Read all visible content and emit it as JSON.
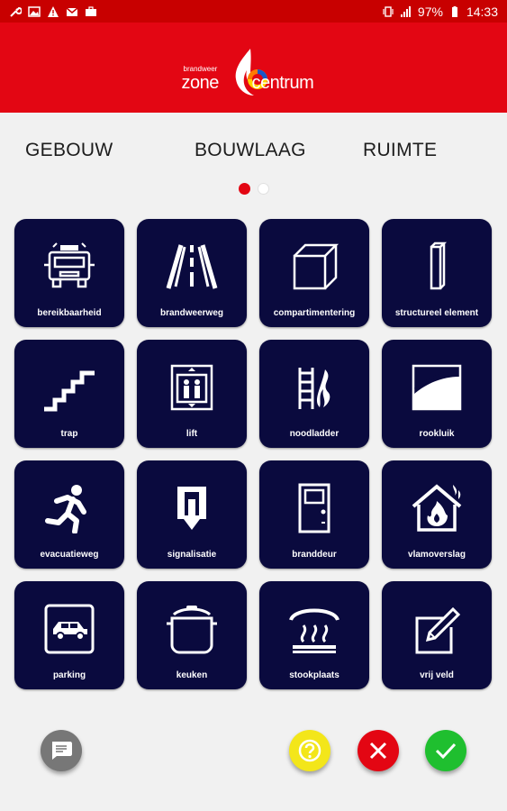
{
  "status_bar": {
    "battery": "97%",
    "time": "14:33",
    "left_icons": [
      "wrench-icon",
      "image-icon",
      "warning-icon",
      "gmail-icon",
      "briefcase-icon"
    ],
    "right_icons": [
      "vibrate-icon",
      "signal-icon",
      "battery-icon"
    ]
  },
  "header": {
    "brand_small": "brandweer",
    "brand_zone": "zone",
    "brand_centrum": "centrum",
    "background": "#e30613"
  },
  "tabs": [
    {
      "label": "GEBOUW"
    },
    {
      "label": "BOUWLAAG"
    },
    {
      "label": "RUIMTE"
    }
  ],
  "pager": {
    "active": 0,
    "count": 2
  },
  "tiles": [
    {
      "label": "bereikbaarheid",
      "icon": "fire-truck-icon"
    },
    {
      "label": "brandweerweg",
      "icon": "road-icon"
    },
    {
      "label": "compartimentering",
      "icon": "cube-icon"
    },
    {
      "label": "structureel element",
      "icon": "column-icon"
    },
    {
      "label": "trap",
      "icon": "stairs-icon"
    },
    {
      "label": "lift",
      "icon": "elevator-icon"
    },
    {
      "label": "noodladder",
      "icon": "ladder-icon"
    },
    {
      "label": "rookluik",
      "icon": "smoke-hatch-icon"
    },
    {
      "label": "evacuatieweg",
      "icon": "running-man-icon"
    },
    {
      "label": "signalisatie",
      "icon": "exit-sign-icon"
    },
    {
      "label": "branddeur",
      "icon": "door-icon"
    },
    {
      "label": "vlamoverslag",
      "icon": "burning-house-icon"
    },
    {
      "label": "parking",
      "icon": "car-icon"
    },
    {
      "label": "keuken",
      "icon": "cooking-pot-icon"
    },
    {
      "label": "stookplaats",
      "icon": "heater-icon"
    },
    {
      "label": "vrij veld",
      "icon": "pencil-icon"
    }
  ],
  "actions": {
    "chat": "chat-icon",
    "help": "help-icon",
    "cancel": "close-icon",
    "confirm": "check-icon"
  },
  "colors": {
    "tile_bg": "#0a0a3e",
    "accent_red": "#e30613",
    "help_yellow": "#f3e61a",
    "confirm_green": "#1fbf2f"
  }
}
